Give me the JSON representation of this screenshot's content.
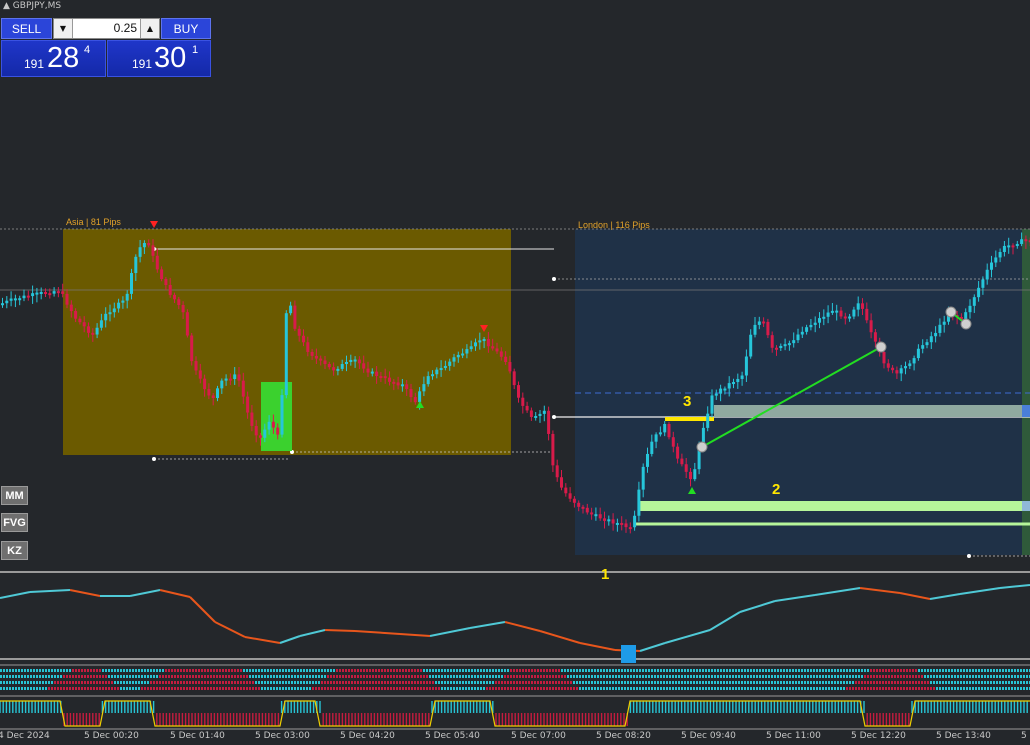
{
  "window": {
    "symbol": "GBPJPY,MS"
  },
  "trade_panel": {
    "sell_label": "SELL",
    "buy_label": "BUY",
    "lot_size": "0.25",
    "sell_price": {
      "prefix": "191",
      "big": "28",
      "sup": "4"
    },
    "buy_price": {
      "prefix": "191",
      "big": "30",
      "sup": "1"
    }
  },
  "side_buttons": [
    "MM",
    "FVG",
    "KZ"
  ],
  "sessions": {
    "asia": {
      "label": "Asia | 81 Pips",
      "color": "#6b5a00"
    },
    "london": {
      "label": "London | 116 Pips",
      "color": "#1f3147"
    }
  },
  "annotations": [
    "1",
    "2",
    "3"
  ],
  "time_axis": [
    "4 Dec 2024",
    "5 Dec 00:20",
    "5 Dec 01:40",
    "5 Dec 03:00",
    "5 Dec 04:20",
    "5 Dec 05:40",
    "5 Dec 07:00",
    "5 Dec 08:20",
    "5 Dec 09:40",
    "5 Dec 11:00",
    "5 Dec 12:20",
    "5 Dec 13:40",
    "5"
  ],
  "colors": {
    "background": "#24272b",
    "bull_candle": "#26c6da",
    "bear_candle": "#d81b4a",
    "fvg_green": "#b6f59a",
    "osc_up": "#4fc9d6",
    "osc_down": "#e8561c",
    "annotation": "#ffe600"
  },
  "icons": {
    "down_arrow": "red-down-arrow-icon",
    "up_arrow": "green-up-arrow-icon",
    "collapse": "triangle-up-icon"
  }
}
